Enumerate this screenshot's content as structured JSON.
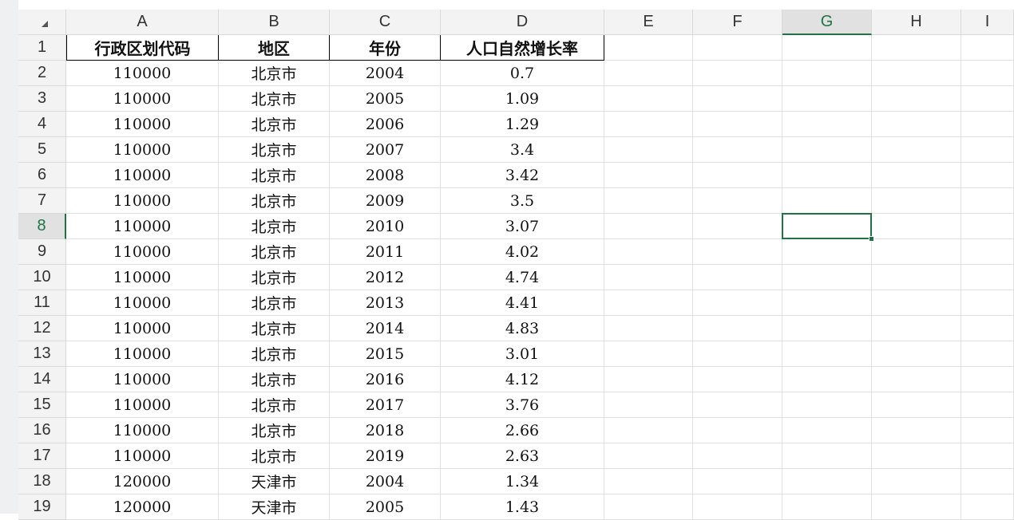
{
  "sheet": {
    "columns": [
      "A",
      "B",
      "C",
      "D",
      "E",
      "F",
      "G",
      "H",
      "I"
    ],
    "selected_column": "G",
    "selected_row": "8",
    "selected_cell": "G8",
    "accent_color": "#217346",
    "corner_icon": "select-all-triangle-icon",
    "rows": [
      {
        "num": "1",
        "cells": [
          "行政区划代码",
          "地区",
          "年份",
          "人口自然增长率"
        ]
      },
      {
        "num": "2",
        "cells": [
          "110000",
          "北京市",
          "2004",
          "0.7"
        ]
      },
      {
        "num": "3",
        "cells": [
          "110000",
          "北京市",
          "2005",
          "1.09"
        ]
      },
      {
        "num": "4",
        "cells": [
          "110000",
          "北京市",
          "2006",
          "1.29"
        ]
      },
      {
        "num": "5",
        "cells": [
          "110000",
          "北京市",
          "2007",
          "3.4"
        ]
      },
      {
        "num": "6",
        "cells": [
          "110000",
          "北京市",
          "2008",
          "3.42"
        ]
      },
      {
        "num": "7",
        "cells": [
          "110000",
          "北京市",
          "2009",
          "3.5"
        ]
      },
      {
        "num": "8",
        "cells": [
          "110000",
          "北京市",
          "2010",
          "3.07"
        ]
      },
      {
        "num": "9",
        "cells": [
          "110000",
          "北京市",
          "2011",
          "4.02"
        ]
      },
      {
        "num": "10",
        "cells": [
          "110000",
          "北京市",
          "2012",
          "4.74"
        ]
      },
      {
        "num": "11",
        "cells": [
          "110000",
          "北京市",
          "2013",
          "4.41"
        ]
      },
      {
        "num": "12",
        "cells": [
          "110000",
          "北京市",
          "2014",
          "4.83"
        ]
      },
      {
        "num": "13",
        "cells": [
          "110000",
          "北京市",
          "2015",
          "3.01"
        ]
      },
      {
        "num": "14",
        "cells": [
          "110000",
          "北京市",
          "2016",
          "4.12"
        ]
      },
      {
        "num": "15",
        "cells": [
          "110000",
          "北京市",
          "2017",
          "3.76"
        ]
      },
      {
        "num": "16",
        "cells": [
          "110000",
          "北京市",
          "2018",
          "2.66"
        ]
      },
      {
        "num": "17",
        "cells": [
          "110000",
          "北京市",
          "2019",
          "2.63"
        ]
      },
      {
        "num": "18",
        "cells": [
          "120000",
          "天津市",
          "2004",
          "1.34"
        ]
      },
      {
        "num": "19",
        "cells": [
          "120000",
          "天津市",
          "2005",
          "1.43"
        ]
      }
    ]
  }
}
